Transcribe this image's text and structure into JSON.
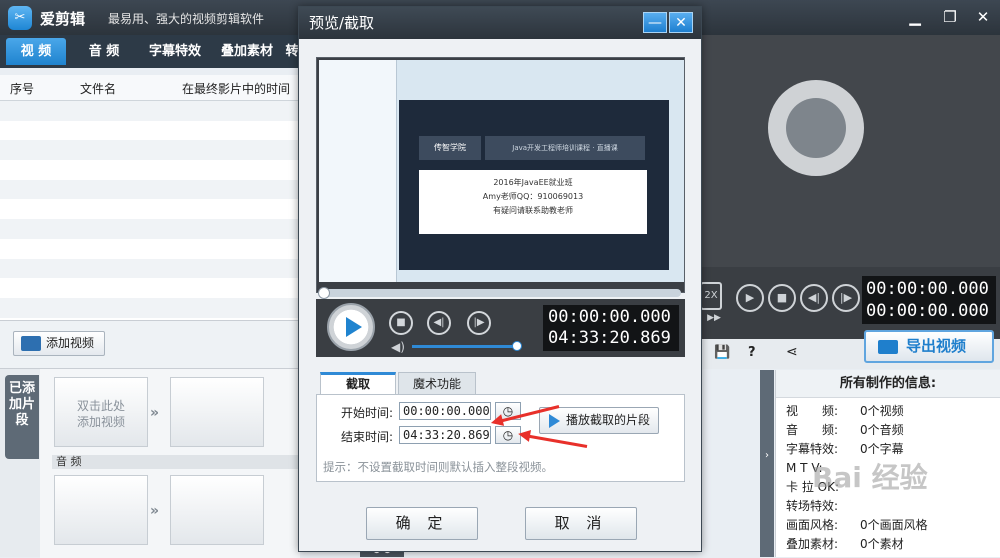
{
  "app": {
    "logo": "✂",
    "name": "爱剪辑",
    "slogan": "最易用、强大的视频剪辑软件"
  },
  "tabs": [
    {
      "label": "视 频",
      "active": true
    },
    {
      "label": "音 频"
    },
    {
      "label": "字幕特效"
    },
    {
      "label": "叠加素材"
    },
    {
      "label": "转"
    }
  ],
  "filelist": {
    "col_index": "序号",
    "col_name": "文件名",
    "col_time": "在最终影片中的时间"
  },
  "add_video": "添加视频",
  "timeline": {
    "side_tab": "已添加片段",
    "placeholder_line1": "双击此处",
    "placeholder_line2": "添加视频",
    "audio_label": "音 频"
  },
  "main_player": {
    "speed": "2X",
    "time_current": "00:00:00.000",
    "time_total": "00:00:00.000"
  },
  "export_button": "导出视频",
  "info": {
    "title": "所有制作的信息:",
    "rows": [
      {
        "k": "视　　频:",
        "v": "0个视频"
      },
      {
        "k": "音　　频:",
        "v": "0个音频"
      },
      {
        "k": "字幕特效:",
        "v": "0个字幕"
      },
      {
        "k": "M T V:",
        "v": ""
      },
      {
        "k": "卡 拉 OK:",
        "v": ""
      },
      {
        "k": "转场特效:",
        "v": ""
      },
      {
        "k": "画面风格:",
        "v": "0个画面风格"
      },
      {
        "k": "叠加素材:",
        "v": "0个素材"
      }
    ]
  },
  "dialog": {
    "title": "预览/截取",
    "minimize": "—",
    "close": "✕",
    "preview": {
      "logo_text": "传智学院",
      "banner_text": "Java开发工程师培训课程 · 直播课",
      "slide_line1": "2016年JavaEE就业班",
      "slide_line2": "Amy老师QQ：910069013",
      "slide_line3": "有疑问请联系助教老师"
    },
    "time_current": "00:00:00.000",
    "time_total": "04:33:20.869",
    "tabs": [
      {
        "label": "截取",
        "active": true
      },
      {
        "label": "魔术功能"
      }
    ],
    "start_label": "开始时间:",
    "start_value": "00:00:00.000",
    "end_label": "结束时间:",
    "end_value": "04:33:20.869",
    "play_segment": "播放截取的片段",
    "hint": "提示：不设置截取时间则默认插入整段视频。",
    "ok": "确 定",
    "cancel": "取 消"
  },
  "watermark": "Bai 经验",
  "colors": {
    "accent": "#1f83cf",
    "dark": "#2c343c",
    "arrow": "#e8302a"
  }
}
